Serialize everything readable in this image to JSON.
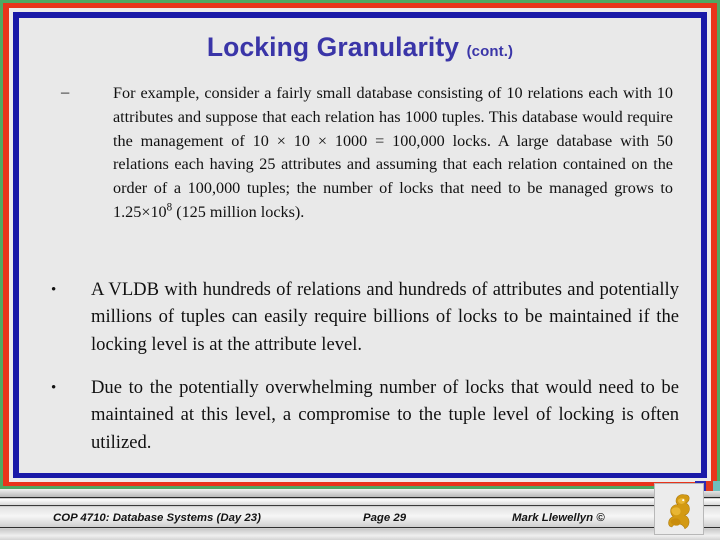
{
  "slide": {
    "title_main": "Locking Granularity",
    "title_suffix": "(cont.)",
    "title_color": "#3a35a8",
    "background_color": "#e9e9e9",
    "border_colors": {
      "outer_green": "#4fa863",
      "red": "#e8341c",
      "white_gap": "#ececec",
      "navy": "#1a1aa8"
    }
  },
  "body": {
    "sub_item": {
      "marker": "–",
      "text_part1": "For example, consider a fairly small database consisting of 10 relations each with 10 attributes and suppose that each relation has 1000 tuples.  This database would require the management of 10 × 10 × 1000 = 100,000 locks.  A large database with 50 relations each having 25 attributes and assuming that each relation contained on the order of a 100,000 tuples; the number of locks that need to be managed grows to 1.25×10",
      "exponent": "8",
      "text_part2": " (125 million locks)."
    },
    "bullets": [
      {
        "marker": "•",
        "text": "A VLDB with hundreds of relations and hundreds of attributes and potentially millions of tuples can easily require billions of locks to be maintained if the locking level is at the attribute level."
      },
      {
        "marker": "•",
        "text": "Due to the potentially overwhelming number of locks that would need to be maintained at this level, a compromise to the tuple level of locking is often utilized."
      }
    ]
  },
  "footer": {
    "course": "COP 4710: Database Systems  (Day 23)",
    "page": "Page 29",
    "author": "Mark Llewellyn ©",
    "logo_name": "pegasus-logo",
    "logo_color": "#d39a14"
  }
}
